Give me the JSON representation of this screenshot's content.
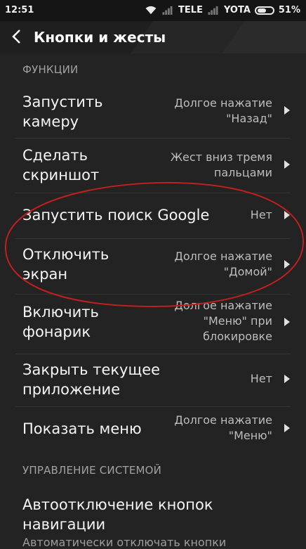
{
  "status_bar": {
    "time": "12:51",
    "carrier1": "TELE",
    "carrier2": "YOTA",
    "battery": "51%"
  },
  "header": {
    "title": "Кнопки и жесты"
  },
  "sections": {
    "functions": "ФУНКЦИИ",
    "system": "УПРАВЛЕНИЕ СИСТЕМОЙ"
  },
  "rows": [
    {
      "label": [
        "Запустить",
        "камеру"
      ],
      "value": [
        "Долгое нажатие",
        "\"Назад\""
      ]
    },
    {
      "label": [
        "Сделать",
        "скриншот"
      ],
      "value": [
        "Жест вниз тремя",
        "пальцами"
      ]
    },
    {
      "label": [
        "Запустить поиск Google"
      ],
      "value": [
        "Нет"
      ]
    },
    {
      "label": [
        "Отключить",
        "экран"
      ],
      "value": [
        "Долгое нажатие",
        "\"Домой\""
      ]
    },
    {
      "label": [
        "Включить",
        "фонарик"
      ],
      "value": [
        "Долгое нажатие",
        "\"Меню\" при",
        "блокировке"
      ]
    },
    {
      "label": [
        "Закрыть текущее",
        "приложение"
      ],
      "value": [
        "Нет"
      ]
    },
    {
      "label": [
        "Показать меню"
      ],
      "value": [
        "Долгое нажатие",
        "\"Меню\""
      ]
    }
  ],
  "system_item": {
    "title": [
      "Автоотключение кнопок",
      "навигации"
    ],
    "subtitle": "Автоматически отключать кнопки"
  },
  "annotation_color": "#c0201f"
}
